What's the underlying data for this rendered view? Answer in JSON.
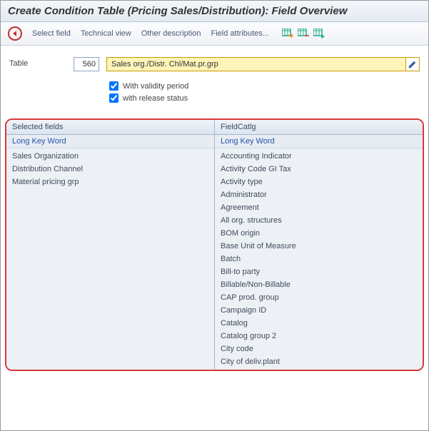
{
  "title": "Create Condition Table (Pricing Sales/Distribution): Field Overview",
  "toolbar": {
    "select_field": "Select field",
    "technical_view": "Technical view",
    "other_description": "Other description",
    "field_attributes": "Field attributes..."
  },
  "form": {
    "table_label": "Table",
    "table_number": "560",
    "table_name": "Sales org./Distr. Chl/Mat.pr.grp"
  },
  "checks": {
    "validity": "With validity period",
    "release": "with release status"
  },
  "left": {
    "header": "Selected fields",
    "sub": "Long Key Word",
    "items": [
      "Sales Organization",
      "Distribution Channel",
      "Material pricing grp"
    ]
  },
  "right": {
    "header": "FieldCatlg",
    "sub": "Long Key Word",
    "items": [
      "Accounting Indicator",
      "Activity Code GI Tax",
      "Activity type",
      "Administrator",
      "Agreement",
      "All org. structures",
      "BOM origin",
      "Base Unit of Measure",
      "Batch",
      "Bill-to party",
      "Billable/Non-Billable",
      "CAP prod. group",
      "Campaign ID",
      "Catalog",
      "Catalog group 2",
      "City code",
      "City of deliv.plant"
    ]
  }
}
